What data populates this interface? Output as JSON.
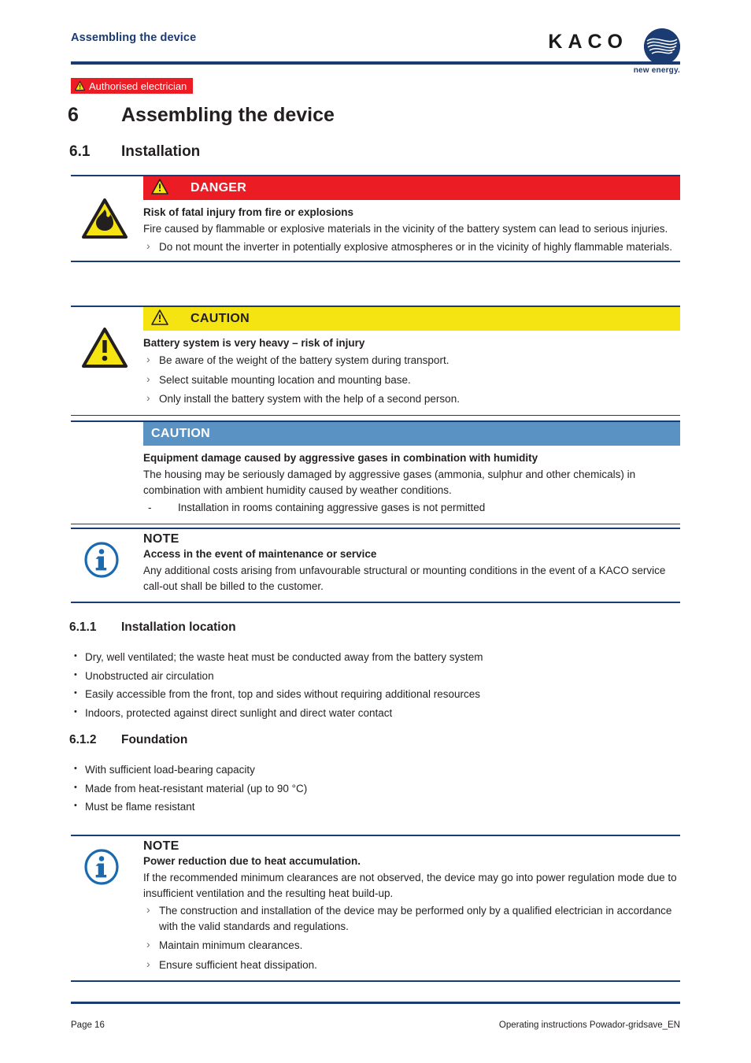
{
  "header": {
    "title": "Assembling the device",
    "logo_word": "KACO",
    "logo_tagline": "new energy.",
    "logo_mark_icon": "kaco-swoosh-icon"
  },
  "audience_badge": {
    "label": "Authorised electrician",
    "icon": "warning-triangle-icon",
    "bg_color": "#EC1C24",
    "text_color": "#FFFFFF"
  },
  "headings": {
    "chapter_number": "6",
    "chapter_title": "Assembling the device",
    "section_number": "6.1",
    "section_title": "Installation",
    "sub1_number": "6.1.1",
    "sub1_title": "Installation location",
    "sub2_number": "6.1.2",
    "sub2_title": "Foundation"
  },
  "colors": {
    "brand_blue": "#1B3C72",
    "danger_red": "#EC1C24",
    "caution_yellow": "#F5E411",
    "notice_blue": "#5B92C4",
    "body_text": "#231F20"
  },
  "admonitions": [
    {
      "id": "danger-fire",
      "level": "DANGER",
      "bar_label": "DANGER",
      "bar_icon": "warning-triangle-icon",
      "side_icon": "fire-hazard-triangle-icon",
      "subhead": "Risk of fatal injury from fire or explosions",
      "paragraphs": [
        "Fire caused by flammable or explosive materials in the vicinity of the battery system can lead to serious injuries."
      ],
      "bullets": [
        "Do not mount the inverter in potentially explosive atmospheres or in the vicinity of highly flammable materials."
      ]
    },
    {
      "id": "caution-weight",
      "level": "CAUTION",
      "bar_label": "CAUTION",
      "bar_icon": "warning-triangle-icon",
      "side_icon": "general-warning-triangle-icon",
      "subhead": "Battery system is very heavy – risk of injury",
      "paragraphs": [],
      "bullets": [
        "Be aware of the weight of the battery system during transport.",
        "Select suitable mounting location and mounting base.",
        "Only install the battery system with the help of a second person."
      ]
    },
    {
      "id": "notice-gases",
      "level": "NOTICE",
      "bar_label": "CAUTION",
      "bar_icon": "",
      "side_icon": "",
      "subhead": "Equipment damage caused by aggressive gases in combination with humidity",
      "paragraphs": [
        "The housing may be seriously damaged by aggressive gases (ammonia, sulphur and other chemicals) in combination with ambient humidity caused by weather conditions."
      ],
      "dashes": [
        "Installation in rooms containing aggressive gases is not permitted"
      ]
    },
    {
      "id": "note-access",
      "level": "NOTE",
      "bar_label": "NOTE",
      "side_icon": "info-circle-icon",
      "subhead": "Access in the event of maintenance or service",
      "paragraphs": [
        "Any additional costs arising from unfavourable structural or mounting conditions in the event of a KACO service call-out shall be billed to the customer."
      ],
      "bullets": []
    },
    {
      "id": "note-power-reduction",
      "level": "NOTE",
      "bar_label": "NOTE",
      "side_icon": "info-circle-icon",
      "subhead": "Power reduction due to heat accumulation.",
      "paragraphs": [
        "If the recommended minimum clearances are not observed, the device may go into power regulation mode due to insufficient ventilation and the resulting heat build-up."
      ],
      "bullets": [
        "The construction and installation of the device may be performed only by a qualified electrician in accordance with the valid standards and regulations.",
        "Maintain minimum clearances.",
        "Ensure sufficient heat dissipation."
      ]
    }
  ],
  "installation_location_items": [
    "Dry, well ventilated; the waste heat must be conducted away from the battery system",
    "Unobstructed air circulation",
    "Easily accessible from the front, top and sides without requiring additional resources",
    "Indoors, protected against direct sunlight and direct water contact"
  ],
  "foundation_items": [
    "With sufficient load-bearing capacity",
    "Made from heat-resistant material (up to 90 °C)",
    "Must be flame resistant"
  ],
  "footer": {
    "page_label": "Page 16",
    "document_label": "Operating instructions Powador-gridsave_EN"
  }
}
